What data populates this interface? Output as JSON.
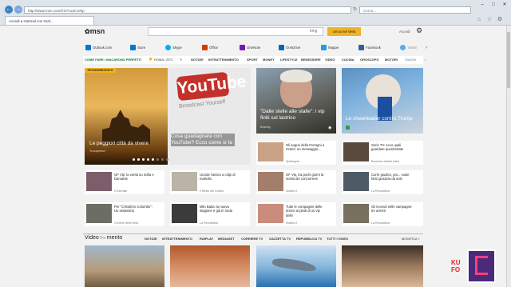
{
  "browser": {
    "address": "http://www.msn.com/it-it/?ocid=iehp",
    "search_placeholder": "Cerca...",
    "tab_title": "Accedi a Hotmail con Outl...",
    "back_icon": "back-arrow-icon",
    "forward_icon": "forward-arrow-icon"
  },
  "header": {
    "logo": "msn",
    "bing_label": "bing",
    "web_button": "cerca nel Web",
    "signin": "Accedi"
  },
  "services": [
    "Outlook.com",
    "Store",
    "Skype",
    "Office",
    "OneNote",
    "OneDrive",
    "Mappe",
    "Facebook",
    "Twitter"
  ],
  "categories": {
    "headline": "COME FARE I MACARONS PERFETTI",
    "weather": "ROMA / 25°C",
    "items": [
      "NOTIZIE",
      "INTRATTENIMENTO",
      "SPORT",
      "MONEY",
      "LIFESTYLE",
      "BENESSERE",
      "VIDEO",
      "CUCINA",
      "OROSCOPO",
      "MOTORI",
      "VIAGGI"
    ]
  },
  "hero": {
    "badge": "SPONSORIZZATO",
    "left_caption": "Le peggiori città da vivere",
    "left_source": "Trovaprezzi",
    "mid_caption": "Cosa guadagnare con YouTube? Ecco come si fa",
    "youtube_logo": "YouTube",
    "youtube_tagline": "Broadcast Yourself",
    "right1_caption": "\"Dalle stelle alle stalle\": i vip finiti sul lastrico",
    "right1_source": "Bravety",
    "right2_caption": "Le cheerleader contro Trump",
    "right2_source": ""
  },
  "tiles": [
    {
      "text": "Gli auguri della Ferragni a Fedez: un messaggio...",
      "source": "Spettegolo"
    },
    {
      "text": "Serie TV: ecco quali guardare quest'estate",
      "source": "Business Insider Italia"
    },
    {
      "text": "GF Vip: la verità su Sofia e Damante",
      "source": "Il Giornale"
    },
    {
      "text": "Uccide l'amico a colpi di martello",
      "source": "Il Resto del Carlino"
    },
    {
      "text": "GF Vip, tra pochi giorni la scelta dei concorrenti",
      "source": "Notizie.it"
    },
    {
      "text": "Corre giudice, poi... vuole farsi giustizia da solo",
      "source": "La Repubblica"
    },
    {
      "text": "Per \"Cristoforo Colombo\": Un assassino",
      "source": "Corriere della Sera"
    },
    {
      "text": "Milo Baba: la nuova stagione è già in onda",
      "source": "La Repubblica"
    },
    {
      "text": "Tutte le compagnie delle donne ai piedi di un vip dello",
      "source": "Notizie.it"
    },
    {
      "text": "Gli incendi nelle campagne: tre arresti",
      "source": "La Repubblica"
    }
  ],
  "video_bar": {
    "title": "Video",
    "subtitle": "mento",
    "items": [
      "NOTIZIE",
      "INTRATTENIMENTO",
      "RAIPLAY",
      "MEDIASET",
      "CORRIERE TV",
      "GAZZETTA TV",
      "REPUBBLICA TV",
      "TUTTI I VIDEO"
    ],
    "modify": "MODIFICA"
  },
  "colors": {
    "accent": "#f0b323",
    "msn_blue": "#0078d7",
    "skype": "#00aff0",
    "office": "#d83b01",
    "facebook": "#3b5998",
    "twitter": "#55acee"
  }
}
